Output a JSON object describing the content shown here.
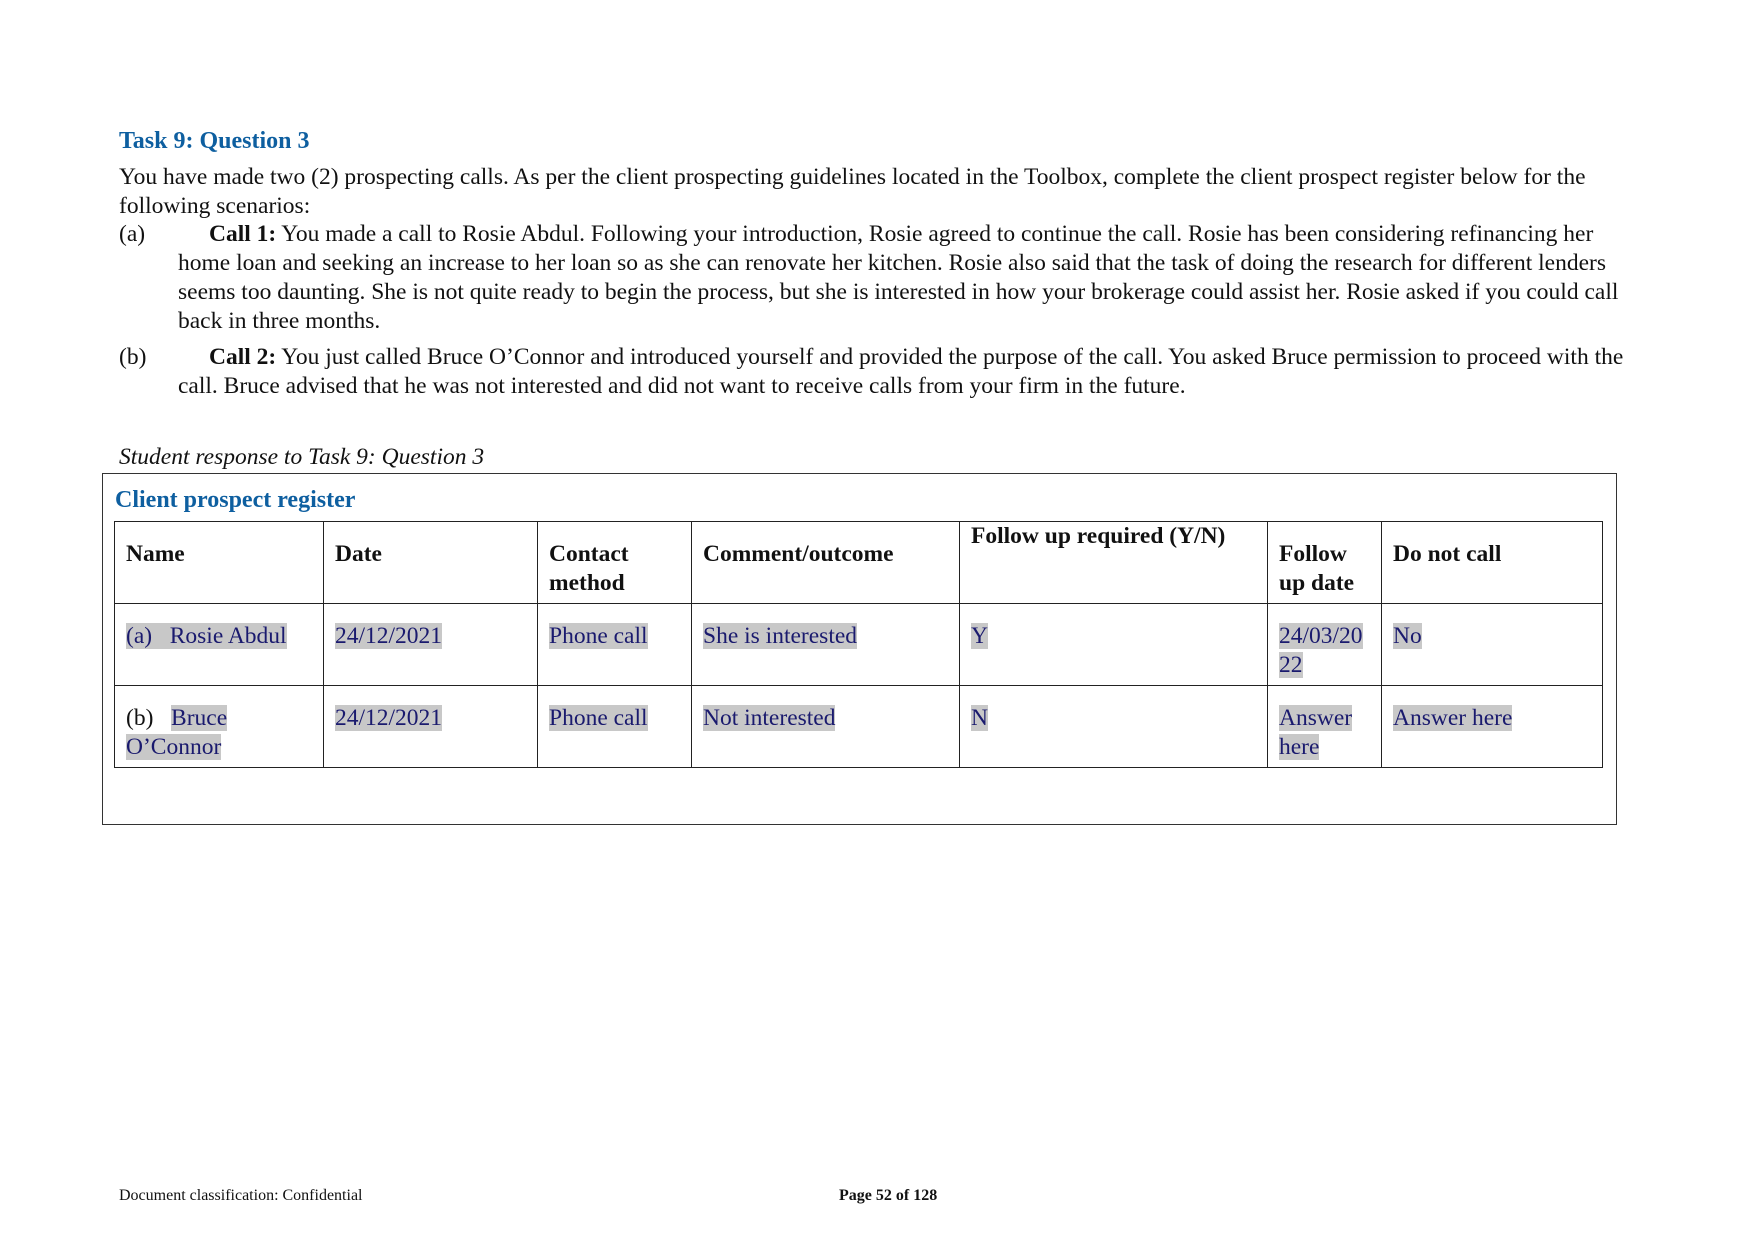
{
  "task": {
    "title": "Task 9: Question 3",
    "intro": "You have made two (2) prospecting calls. As per the client prospecting guidelines located in the Toolbox, complete the client prospect register below for the following scenarios:",
    "scenarios": [
      {
        "label": "(a)",
        "heading": "Call 1:",
        "text": " You made a call to Rosie Abdul. Following your introduction, Rosie agreed to continue the call. Rosie has been considering refinancing her home loan and seeking an increase to her loan so as she can renovate her kitchen. Rosie also said that the task of doing the research for different lenders seems too daunting. She is not quite ready to begin the process, but she is interested in how your brokerage could assist her. Rosie asked if you could call back in three months."
      },
      {
        "label": "(b)",
        "heading": "Call 2:",
        "text": " You just called Bruce O’Connor and introduced yourself and provided the purpose of the call. You asked Bruce permission to proceed with the call. Bruce advised that he was not interested and did not want to receive calls from your firm in the future."
      }
    ]
  },
  "response": {
    "label": "Student response to Task 9: Question 3",
    "register_title": "Client prospect register",
    "columns": [
      "Name",
      "Date",
      "Contact method",
      "Comment/outcome",
      "Follow up required (Y/N)",
      "Follow up date",
      "Do not call"
    ],
    "rows": [
      {
        "prefix": "(a)",
        "name": "Rosie Abdul",
        "date": "24/12/2021",
        "contact_method": "Phone call",
        "comment": "She is interested",
        "follow_up_required": "Y",
        "follow_up_date": "24/03/2022",
        "do_not_call": "No"
      },
      {
        "prefix": "(b)",
        "name": "Bruce O’Connor",
        "date": "24/12/2021",
        "contact_method": "Phone call",
        "comment": "Not interested",
        "follow_up_required": "N",
        "follow_up_date": "Answer here",
        "do_not_call": "Answer here"
      }
    ]
  },
  "footer": {
    "classification": "Document classification: Confidential",
    "page": "Page 52 of 128"
  },
  "colors": {
    "heading_blue": "#0e5fa0",
    "answer_text": "#1a1a6e",
    "answer_highlight": "#c8c8c8"
  }
}
